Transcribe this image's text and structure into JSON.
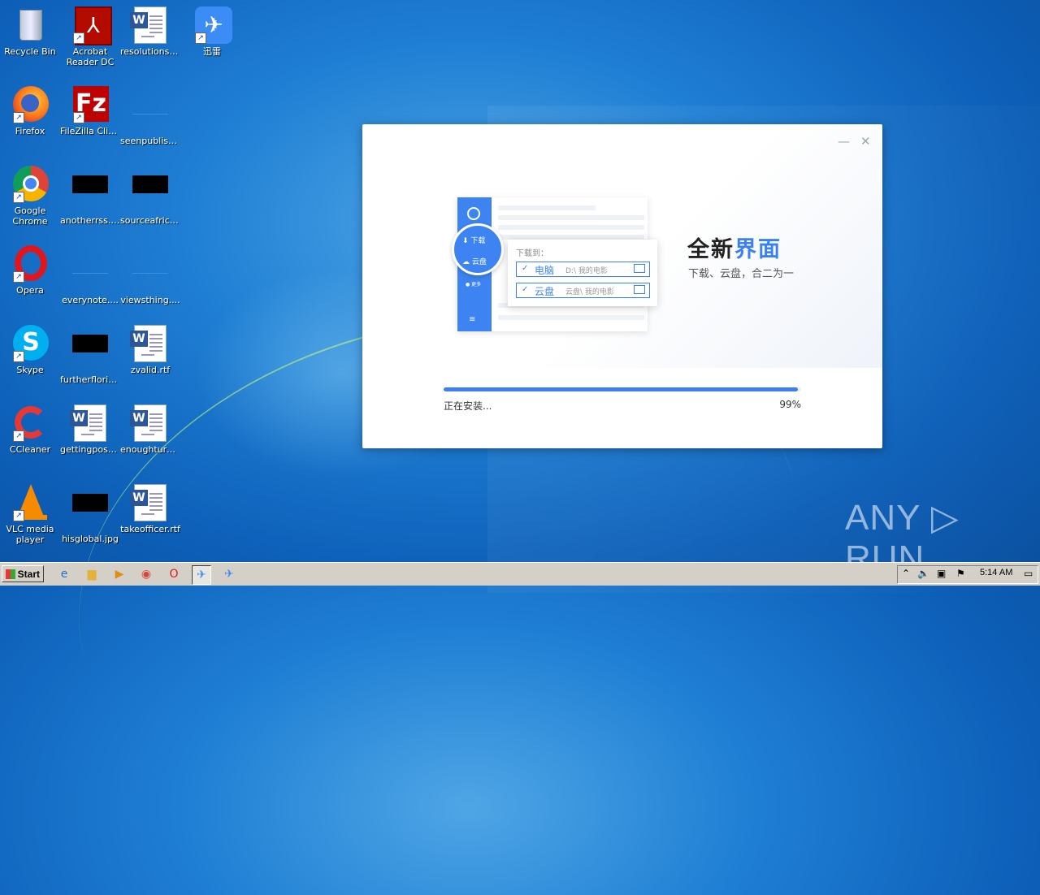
{
  "desktop": {
    "icons": [
      {
        "label": "Recycle Bin"
      },
      {
        "label": "Acrobat Reader DC"
      },
      {
        "label": "resolutions...."
      },
      {
        "label": "迅雷"
      },
      {
        "label": "Firefox"
      },
      {
        "label": "FileZilla Client"
      },
      {
        "label": "seenpublish...."
      },
      {
        "label": "Google Chrome"
      },
      {
        "label": "anotherrss.jpg"
      },
      {
        "label": "sourceafric...."
      },
      {
        "label": "Opera"
      },
      {
        "label": "everynote...."
      },
      {
        "label": "viewsthing...."
      },
      {
        "label": "Skype"
      },
      {
        "label": "furtherflorid..."
      },
      {
        "label": "zvalid.rtf"
      },
      {
        "label": "CCleaner"
      },
      {
        "label": "gettingpost...."
      },
      {
        "label": "enoughturn...."
      },
      {
        "label": "VLC media player"
      },
      {
        "label": "hisglobal.jpg"
      },
      {
        "label": "takeofficer.rtf"
      }
    ]
  },
  "installer": {
    "minimize": "—",
    "close": "✕",
    "headline_part1": "全新",
    "headline_part2": "界面",
    "subline": "下载、云盘，合二为一",
    "illustration": {
      "download_tab": "下载",
      "cloud_tab": "云盘",
      "more_tab": "更多",
      "popup_label": "下载到：",
      "option1_name": "电脑",
      "option1_path": "D:\\ 我的电影",
      "option2_name": "云盘",
      "option2_path": "云盘\\ 我的电影"
    },
    "status_text": "正在安装...",
    "progress_percent_text": "99%",
    "progress_fraction": 0.99
  },
  "watermark": "ANY ▷ RUN",
  "taskbar": {
    "start_label": "Start",
    "clock": "5:14 AM"
  }
}
